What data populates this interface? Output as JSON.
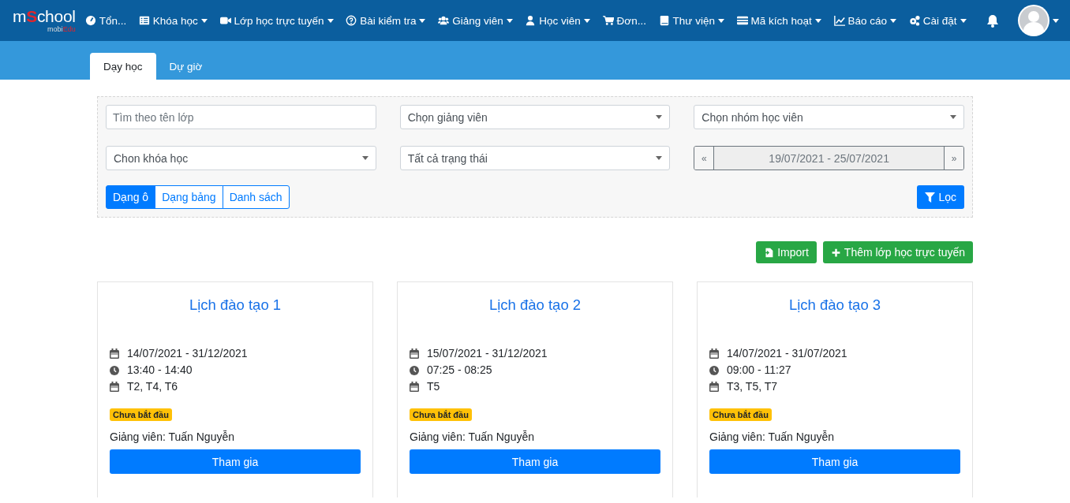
{
  "logo": {
    "main_start": "m",
    "main_accent": "S",
    "main_end": "chool",
    "sub_start": "mobi",
    "sub_accent": "Edu"
  },
  "nav": [
    {
      "kind": "gauge",
      "label": "Tổn...",
      "dropdown": false
    },
    {
      "kind": "list",
      "label": "Khóa học",
      "dropdown": true
    },
    {
      "kind": "video",
      "label": "Lớp học trực tuyến",
      "dropdown": true
    },
    {
      "kind": "question",
      "label": "Bài kiểm tra",
      "dropdown": true
    },
    {
      "kind": "users",
      "label": "Giảng viên",
      "dropdown": true
    },
    {
      "kind": "user",
      "label": "Học viên",
      "dropdown": true
    },
    {
      "kind": "cart",
      "label": "Đơn...",
      "dropdown": false
    },
    {
      "kind": "book",
      "label": "Thư viện",
      "dropdown": true
    },
    {
      "kind": "card",
      "label": "Mã kích hoạt",
      "dropdown": true
    },
    {
      "kind": "chart",
      "label": "Báo cáo",
      "dropdown": true
    },
    {
      "kind": "gears",
      "label": "Cài đặt",
      "dropdown": true
    }
  ],
  "tabs": [
    {
      "label": "Dạy học",
      "selected": true
    },
    {
      "label": "Dự giờ",
      "selected": false
    }
  ],
  "filters": {
    "search": {
      "placeholder": "Tìm theo tên lớp"
    },
    "selects": [
      {
        "value": "Chọn giảng viên"
      },
      {
        "value": "Chọn nhóm học viên"
      },
      {
        "value": "Chon khóa học"
      },
      {
        "value": "Tất cả trạng thái"
      }
    ],
    "date_range": {
      "prev": "«",
      "value": "19/07/2021 - 25/07/2021",
      "next": "»"
    },
    "views": [
      {
        "label": "Dạng ô",
        "selected": true
      },
      {
        "label": "Dạng bảng",
        "selected": false
      },
      {
        "label": "Danh sách",
        "selected": false
      }
    ],
    "filter_button": "Lọc"
  },
  "actions": [
    {
      "kind": "import",
      "label": "Import"
    },
    {
      "kind": "plus",
      "label": "Thêm lớp học trực tuyến"
    }
  ],
  "cards": [
    {
      "title": "Lịch đào tạo 1",
      "date_range": "14/07/2021 - 31/12/2021",
      "time": "13:40 - 14:40",
      "days": "T2, T4, T6",
      "status": "Chưa bắt đầu",
      "teacher": "Giảng viên: Tuấn Nguyễn",
      "button": "Tham gia"
    },
    {
      "title": "Lịch đào tạo 2",
      "date_range": "15/07/2021 - 31/12/2021",
      "time": "07:25 - 08:25",
      "days": "T5",
      "status": "Chưa bắt đầu",
      "teacher": "Giảng viên: Tuấn Nguyễn",
      "button": "Tham gia"
    },
    {
      "title": "Lịch đào tạo 3",
      "date_range": "14/07/2021 - 31/07/2021",
      "time": "09:00 - 11:27",
      "days": "T3, T5, T7",
      "status": "Chưa bắt đầu",
      "teacher": "Giảng viên: Tuấn Nguyễn",
      "button": "Tham gia"
    }
  ]
}
